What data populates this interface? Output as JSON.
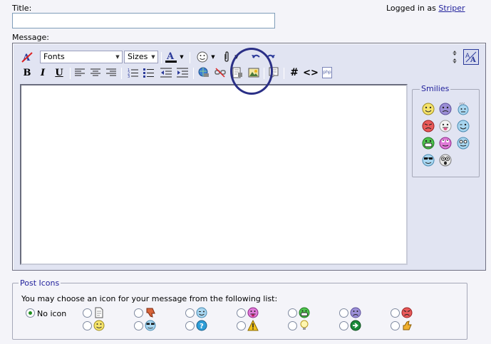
{
  "form": {
    "title_label": "Title:",
    "title_value": "",
    "message_label": "Message:"
  },
  "header": {
    "logged_in_prefix": "Logged in as",
    "username": "Striper"
  },
  "toolbar": {
    "fonts_value": "Fonts",
    "sizes_value": "Sizes",
    "format_labels": {
      "bold": "B",
      "italic": "I",
      "underline": "U"
    },
    "hash_label": "#",
    "code_label": "<>",
    "php_label": "php"
  },
  "smilies": {
    "legend": "Smilies",
    "question_marks": "???"
  },
  "post_icons": {
    "legend": "Post Icons",
    "instruction": "You may choose an icon for your message from the following list:",
    "no_icon_label": "No icon",
    "selected": "no_icon"
  },
  "colors": {
    "accent": "#22229c",
    "editor_bg": "#e1e4f2",
    "highlight": "#2a2f86"
  }
}
